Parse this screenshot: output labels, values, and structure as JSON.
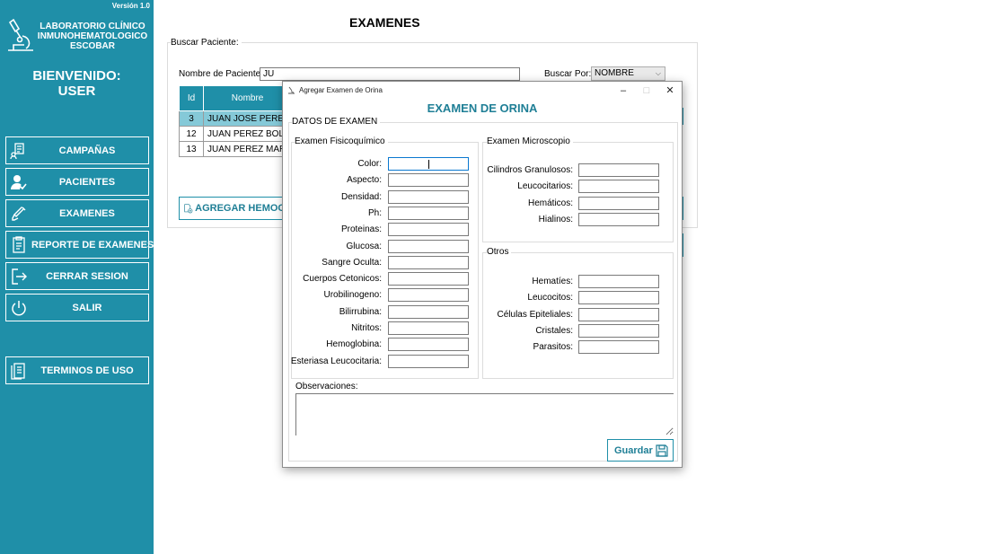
{
  "sidebar": {
    "version": "Versión 1.0",
    "lab_name_1": "LABORATORIO CLÍNICO",
    "lab_name_2": "INMUNOHEMATOLOGICO",
    "lab_name_3": "ESCOBAR",
    "welcome": "BIENVENIDO:",
    "user": "USER",
    "items": [
      {
        "label": "CAMPAÑAS",
        "icon": "campaign-icon"
      },
      {
        "label": "PACIENTES",
        "icon": "patient-icon"
      },
      {
        "label": "EXAMENES",
        "icon": "syringe-icon"
      },
      {
        "label": "REPORTE DE EXAMENES",
        "icon": "report-icon"
      },
      {
        "label": "CERRAR SESION",
        "icon": "logout-icon"
      },
      {
        "label": "SALIR",
        "icon": "power-icon"
      },
      {
        "label": "TERMINOS DE USO",
        "icon": "document-icon"
      }
    ]
  },
  "main": {
    "title": "EXAMENES",
    "search_group": "Buscar Paciente:",
    "name_label": "Nombre de Paciente:",
    "name_value": "JU",
    "search_by_label": "Buscar Por:",
    "search_by_value": "NOMBRE",
    "table": {
      "columns": [
        "Id",
        "Nombre"
      ],
      "rows": [
        {
          "id": "3",
          "name": "JUAN JOSE PEREZ"
        },
        {
          "id": "12",
          "name": "JUAN PEREZ BOLA"
        },
        {
          "id": "13",
          "name": "JUAN PEREZ MART"
        }
      ]
    },
    "add_button": "AGREGAR HEMOG"
  },
  "modal": {
    "window_title": "Agregar Examen de Orina",
    "minimize": "–",
    "maximize": "□",
    "close": "✕",
    "heading": "EXAMEN DE ORINA",
    "datos_group": "DATOS DE EXAMEN",
    "fisico_group": "Examen Fisicoquímico",
    "fisico_fields": [
      "Color:",
      "Aspecto:",
      "Densidad:",
      "Ph:",
      "Proteinas:",
      "Glucosa:",
      "Sangre Oculta:",
      "Cuerpos Cetonicos:",
      "Urobilinogeno:",
      "Bilirrubina:",
      "Nitritos:",
      "Hemoglobina:",
      "Esteriasa Leucocitaria:"
    ],
    "micro_group": "Examen Microscopio",
    "micro_fields": [
      "Cilindros Granulosos:",
      "Leucocitarios:",
      "Hemáticos:",
      "Hialinos:"
    ],
    "otros_group": "Otros",
    "otros_fields": [
      "Hematíes:",
      "Leucocitos:",
      "Células Epiteliales:",
      "Cristales:",
      "Parasitos:"
    ],
    "observaciones_label": "Observaciones:",
    "save_button": "Guardar"
  },
  "colors": {
    "accent": "#1f8fa8",
    "selected_row": "#85c9d8"
  }
}
